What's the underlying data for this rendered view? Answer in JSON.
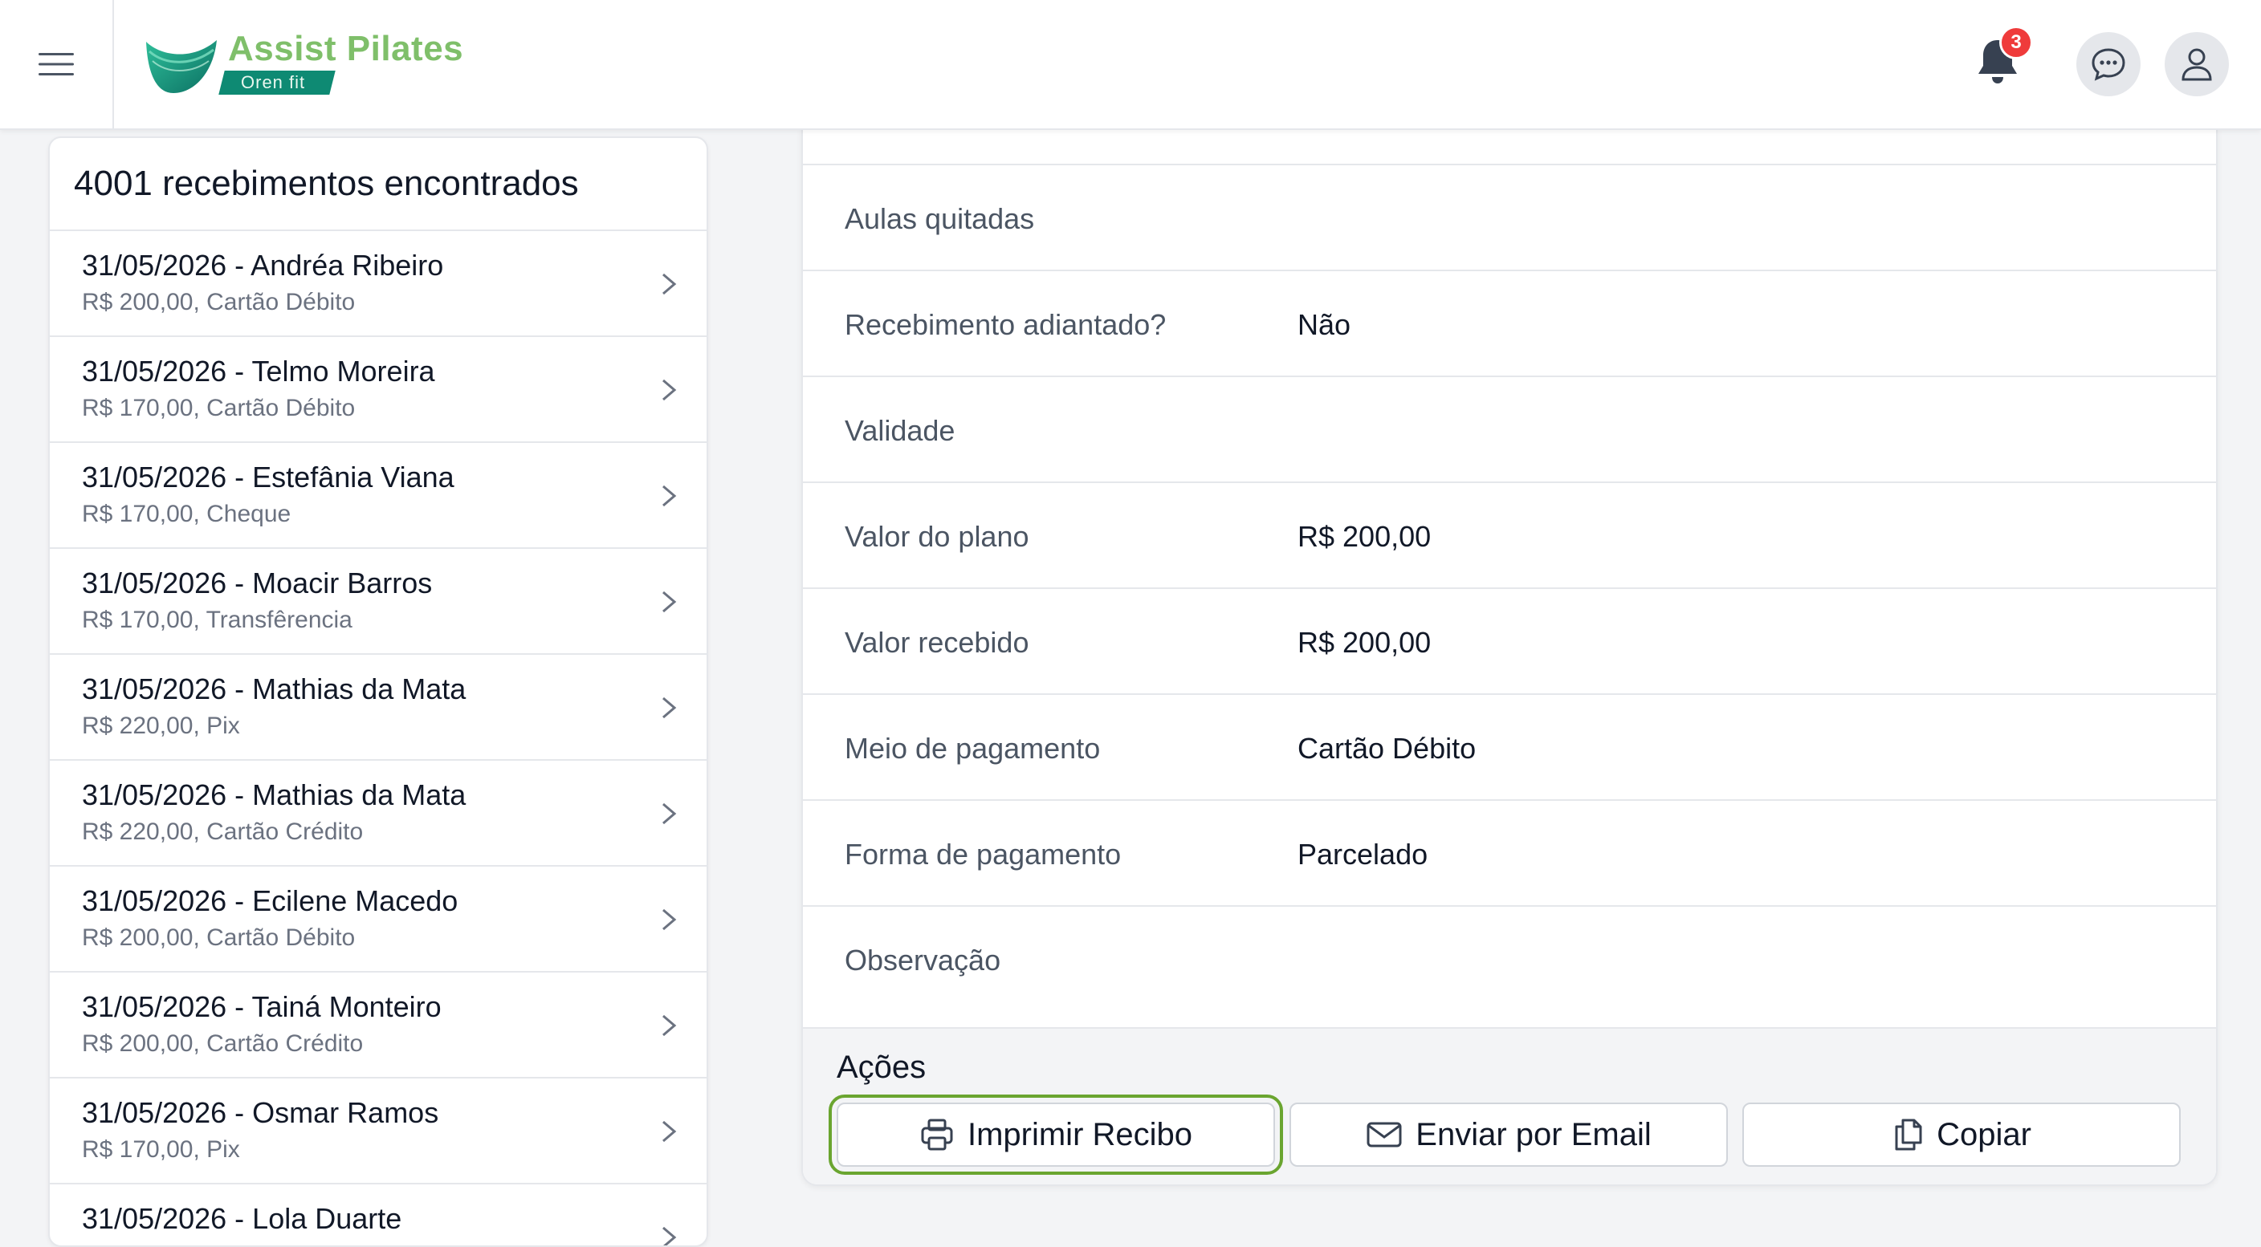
{
  "header": {
    "menu_icon": "hamburger-menu-icon",
    "logo_title": "Assist Pilates",
    "logo_tag": "Oren fit",
    "notifications_count": "3",
    "brand_color": "#7fbf6a",
    "brand_dark": "#0e8a73",
    "badge_color": "#ef3b3b"
  },
  "list": {
    "header": "4001 recebimentos encontrados",
    "items": [
      {
        "title": "31/05/2026 - Andréa Ribeiro",
        "subtitle": "R$ 200,00, Cartão Débito"
      },
      {
        "title": "31/05/2026 - Telmo Moreira",
        "subtitle": "R$ 170,00, Cartão Débito"
      },
      {
        "title": "31/05/2026 - Estefânia Viana",
        "subtitle": "R$ 170,00, Cheque"
      },
      {
        "title": "31/05/2026 - Moacir Barros",
        "subtitle": "R$ 170,00, Transfêrencia"
      },
      {
        "title": "31/05/2026 - Mathias da Mata",
        "subtitle": "R$ 220,00, Pix"
      },
      {
        "title": "31/05/2026 - Mathias da Mata",
        "subtitle": "R$ 220,00, Cartão Crédito"
      },
      {
        "title": "31/05/2026 - Ecilene Macedo",
        "subtitle": "R$ 200,00, Cartão Débito"
      },
      {
        "title": "31/05/2026 - Tainá Monteiro",
        "subtitle": "R$ 200,00, Cartão Crédito"
      },
      {
        "title": "31/05/2026 - Osmar Ramos",
        "subtitle": "R$ 170,00, Pix"
      },
      {
        "title": "31/05/2026 - Lola Duarte",
        "subtitle": ""
      }
    ]
  },
  "detail": {
    "rows": [
      {
        "label": "Aulas quitadas",
        "value": ""
      },
      {
        "label": "Recebimento adiantado?",
        "value": "Não"
      },
      {
        "label": "Validade",
        "value": ""
      },
      {
        "label": "Valor do plano",
        "value": "R$ 200,00"
      },
      {
        "label": "Valor recebido",
        "value": "R$ 200,00"
      },
      {
        "label": "Meio de pagamento",
        "value": "Cartão Débito"
      },
      {
        "label": "Forma de pagamento",
        "value": "Parcelado"
      },
      {
        "label": "Observação",
        "value": ""
      }
    ]
  },
  "actions": {
    "title": "Ações",
    "print_label": "Imprimir Recibo",
    "email_label": "Enviar por Email",
    "copy_label": "Copiar",
    "focus_color": "#6aa530"
  }
}
